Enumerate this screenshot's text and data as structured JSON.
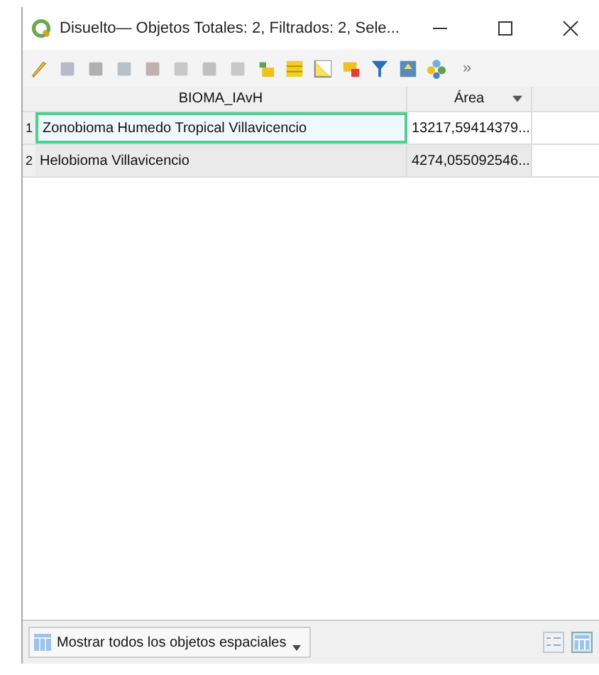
{
  "window": {
    "title": "Disuelto— Objetos Totales: 2, Filtrados: 2, Sele..."
  },
  "toolbar": {
    "overflow": "»"
  },
  "table": {
    "columns": [
      {
        "label": "BIOMA_IAvH",
        "sort_menu": false
      },
      {
        "label": "Área",
        "sort_menu": true
      }
    ],
    "rows": [
      {
        "number": "1",
        "cells": [
          "Zonobioma Humedo Tropical Villavicencio",
          "13217,59414379..."
        ],
        "focused": true
      },
      {
        "number": "2",
        "cells": [
          "Helobioma Villavicencio",
          "4274,055092546..."
        ],
        "focused": false
      }
    ]
  },
  "footer": {
    "filter_button": "Mostrar todos los objetos espaciales"
  }
}
